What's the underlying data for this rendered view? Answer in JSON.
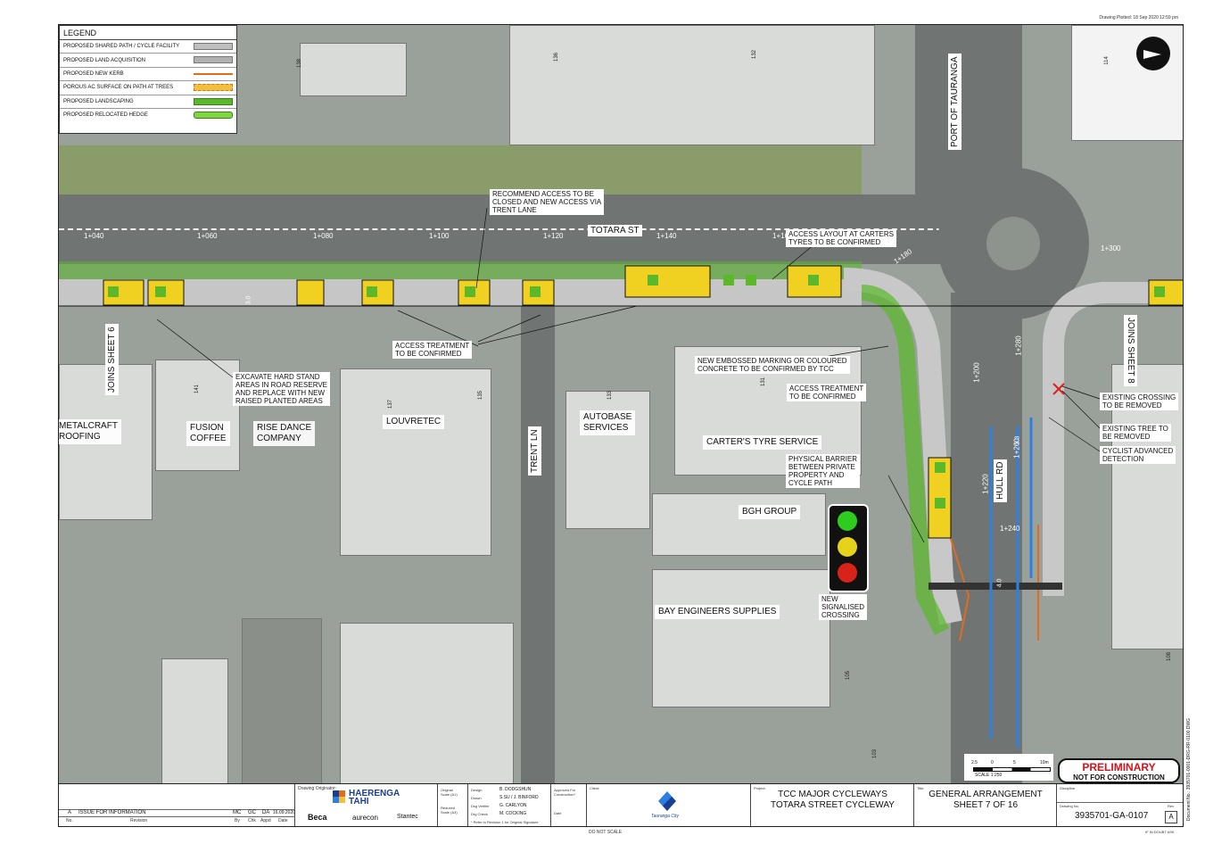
{
  "meta": {
    "plotted": "Drawing Plotted:   18 Sep 2020   12:59 pm",
    "doc_number": "Document No.:   3935701-0001-DRG-RR-0100.DWG",
    "dont_scale": "DO NOT SCALE",
    "if_in_doubt": "IF IN DOUBT ASK"
  },
  "legend": {
    "title": "LEGEND",
    "items": [
      {
        "label": "PROPOSED SHARED PATH / CYCLE FACILITY",
        "color": "#bfbfbf"
      },
      {
        "label": "PROPOSED LAND ACQUISITION",
        "color": "#b0b0b0"
      },
      {
        "label": "PROPOSED NEW KERB",
        "color": "#e36c1c"
      },
      {
        "label": "POROUS AC SURFACE ON PATH AT TREES",
        "color": "#f0c040"
      },
      {
        "label": "PROPOSED LANDSCAPING",
        "color": "#5ab82a"
      },
      {
        "label": "PROPOSED RELOCATED HEDGE",
        "color": "#7fd640"
      }
    ]
  },
  "streets": {
    "totara": "TOTARA ST",
    "port": "PORT OF TAURANGA",
    "trent": "TRENT LN",
    "hull": "HULL RD"
  },
  "joins": {
    "left": "JOINS SHEET 6",
    "right": "JOINS SHEET 8"
  },
  "chainages": [
    "1+040",
    "1+060",
    "1+080",
    "1+100",
    "1+120",
    "1+140",
    "1+160",
    "1+180",
    "1+300",
    "1+200",
    "1+220",
    "1+240",
    "1+260",
    "1+280"
  ],
  "lot_numbers": [
    "136",
    "132",
    "138",
    "114",
    "141",
    "137",
    "135",
    "133",
    "131",
    "105",
    "103",
    "108"
  ],
  "businesses": {
    "metalcraft": "METALCRAFT\nROOFING",
    "fusion": "FUSION\nCOFFEE",
    "rise": "RISE DANCE\nCOMPANY",
    "louvretec": "LOUVRETEC",
    "autobase": "AUTOBASE\nSERVICES",
    "carters": "CARTER'S TYRE SERVICE",
    "bgh": "BGH GROUP",
    "bay": "BAY ENGINEERS SUPPLIES"
  },
  "annotations": {
    "recommend": "RECOMMEND ACCESS TO BE\nCLOSED AND NEW ACCESS VIA\nTRENT LANE",
    "access_layout": "ACCESS LAYOUT AT CARTERS\nTYRES TO BE CONFIRMED",
    "access_treatment_1": "ACCESS TREATMENT\nTO BE CONFIRMED",
    "excavate": "EXCAVATE HARD STAND\nAREAS IN ROAD RESERVE\nAND REPLACE WITH NEW\nRAISED PLANTED AREAS",
    "embossed": "NEW EMBOSSED MARKING OR COLOURED\nCONCRETE TO BE CONFIRMED BY TCC",
    "access_treatment_2": "ACCESS TREATMENT\nTO BE CONFIRMED",
    "barrier": "PHYSICAL BARRIER\nBETWEEN PRIVATE\nPROPERTY AND\nCYCLE PATH",
    "signalised": "NEW\nSIGNALISED\nCROSSING",
    "existing_crossing": "EXISTING CROSSING\nTO BE REMOVED",
    "existing_tree": "EXISTING TREE TO\nBE REMOVED",
    "cyclist": "CYCLIST ADVANCED\nDETECTION",
    "dim_30": "3.0",
    "dim_33": "3.3",
    "dim_40": "4.0"
  },
  "scale": {
    "ticks": [
      "2.5",
      "0",
      "5",
      "10m"
    ],
    "label": "SCALE 1:250"
  },
  "stamp": {
    "line1": "PRELIMINARY",
    "line2": "NOT FOR CONSTRUCTION"
  },
  "title_block": {
    "revision": {
      "rev": "A",
      "text": "ISSUE FOR INFORMATION",
      "by": "MC",
      "chk": "GC",
      "appd": "DA",
      "date": "16.09.2020"
    },
    "revision_headers": {
      "no": "No.",
      "rev": "Revision",
      "by": "By",
      "chk": "Chk",
      "appd": "Appd",
      "date": "Date"
    },
    "originator_label": "Drawing Originator:",
    "originator_logo": "HAERENGA\nTAHI",
    "partners": [
      "Beca",
      "aurecon",
      "Stantec"
    ],
    "scales": [
      "Original\nScale (A1)",
      "Reduced\nScale (A3)"
    ],
    "people": [
      {
        "role": "Design",
        "name": "B. DODGSHUN"
      },
      {
        "role": "Drawn",
        "name": "S.SU / J. BINFORD"
      },
      {
        "role": "Dsg Verifier",
        "name": "G. CARLYON"
      },
      {
        "role": "Drg Check",
        "name": "M. COCKING"
      }
    ],
    "approved": "Approved For\nConstruction*",
    "date_label": "Date",
    "refer": "* Refer to Revision 1 for Original Signature",
    "client_label": "Client:",
    "client_name": "Tauranga City",
    "project_label": "Project:",
    "project": "TCC MAJOR CYCLEWAYS\nTOTARA STREET CYCLEWAY",
    "title_label": "Title:",
    "title": "GENERAL ARRANGEMENT\nSHEET 7 OF 16",
    "discipline_label": "Discipline",
    "drawing_no_label": "Drawing No.",
    "drawing_no": "3935701-GA-0107",
    "rev_label": "Rev",
    "rev_value": "A"
  },
  "signal_colors": [
    "#2ecc1f",
    "#e6d21b",
    "#d8231a"
  ]
}
